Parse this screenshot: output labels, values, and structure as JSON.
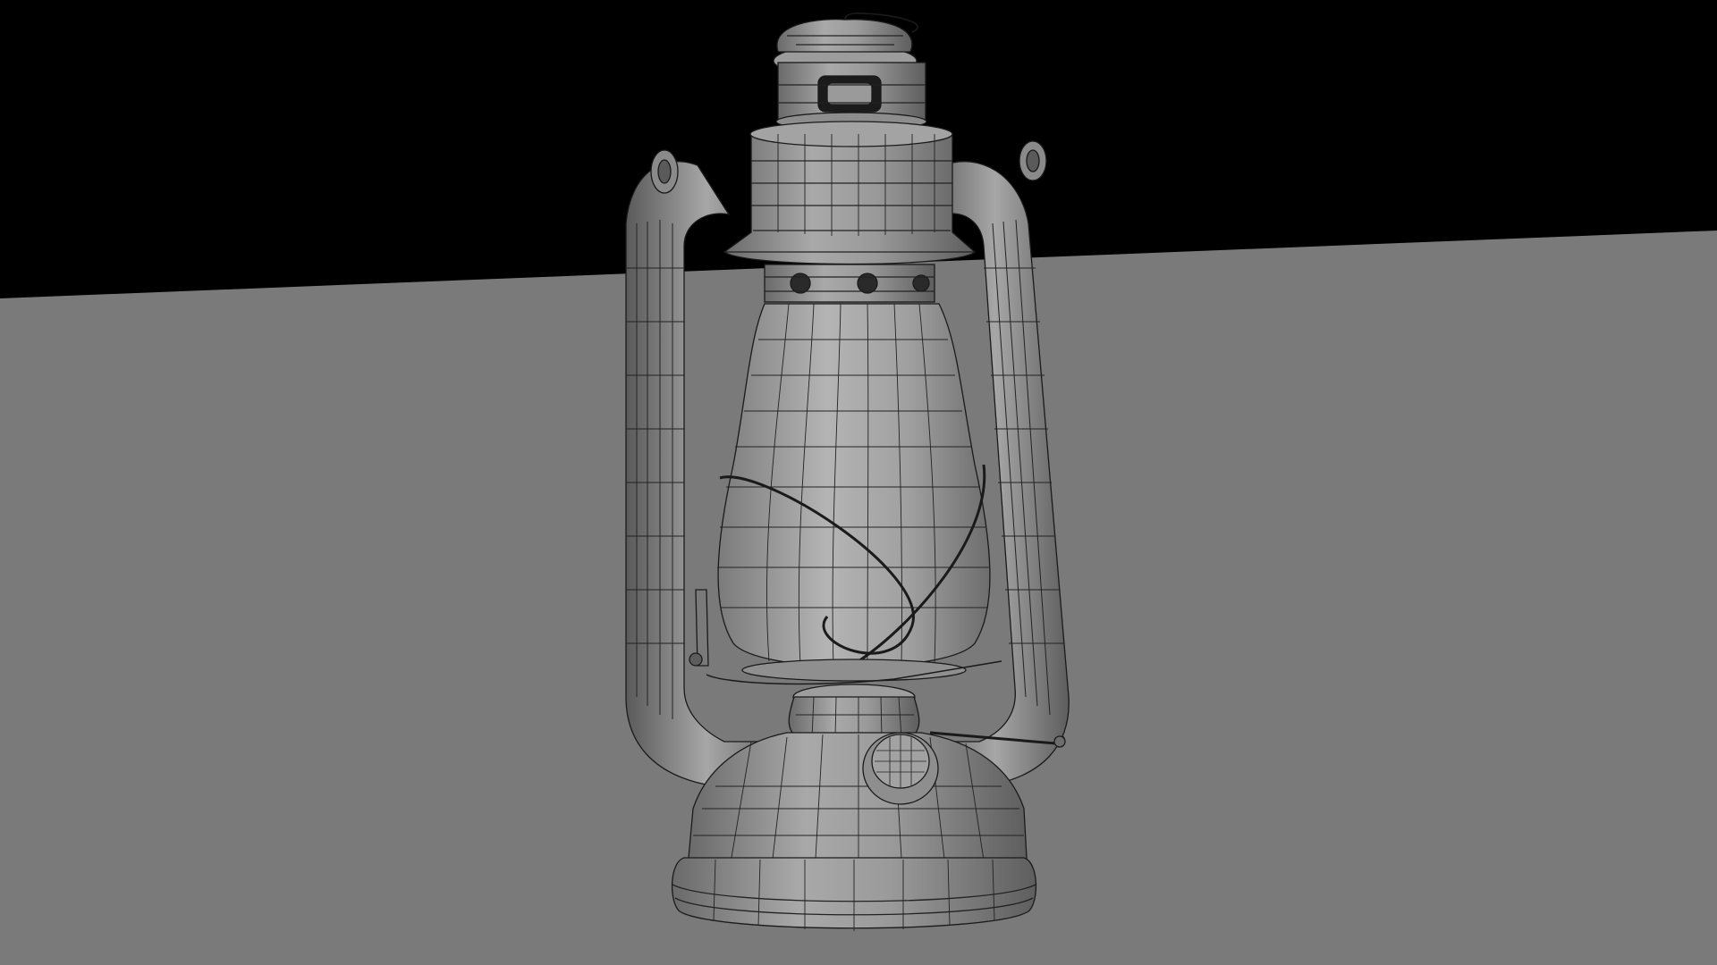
{
  "scene": {
    "subject": "hurricane-lantern",
    "render_style": "wireframe-on-shaded",
    "colors": {
      "background": "#000000",
      "ground": "#7a7a7a",
      "ground_far": "#767676",
      "shell_light": "#a6a6a6",
      "shell_mid": "#8e8e8e",
      "shell_dark": "#6c6c6c",
      "wire": "#1a1a1a"
    }
  }
}
